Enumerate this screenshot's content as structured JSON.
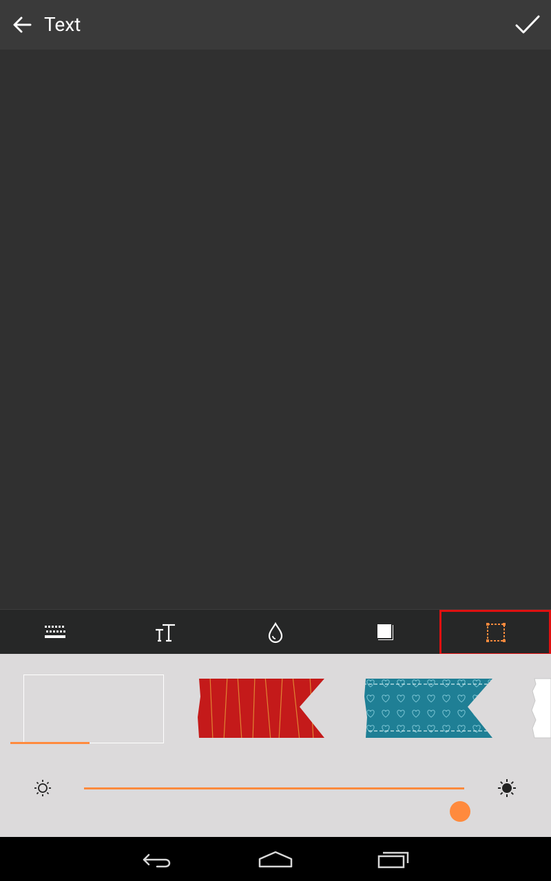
{
  "header": {
    "title": "Text"
  },
  "tabs": [
    {
      "icon": "keyboard-icon",
      "selected": false
    },
    {
      "icon": "font-size-icon",
      "selected": false
    },
    {
      "icon": "color-drop-icon",
      "selected": false
    },
    {
      "icon": "shadow-box-icon",
      "selected": false
    },
    {
      "icon": "frame-dashed-icon",
      "selected": true
    }
  ],
  "backgrounds": [
    {
      "name": "none",
      "selected": true
    },
    {
      "name": "red-ribbon",
      "selected": false
    },
    {
      "name": "teal-hearts-ribbon",
      "selected": false
    },
    {
      "name": "white-torn-ribbon",
      "selected": false
    }
  ],
  "opacity_slider": {
    "value": 1.0
  },
  "colors": {
    "accent": "#ff8a3d",
    "highlight_outline": "#e01010",
    "topbar": "#3a3a3a",
    "canvas": "#303030",
    "tabbar": "#262727",
    "panel": "#dcdadb",
    "navbar": "#000000"
  }
}
